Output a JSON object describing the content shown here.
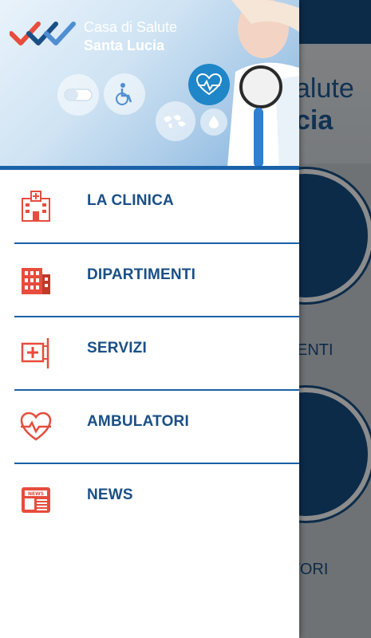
{
  "app": {
    "brand_line_1": "Casa di Salute",
    "brand_line_2": "Santa Lucia"
  },
  "background": {
    "title_line_1": "alute",
    "title_line_2": "cia",
    "label_1": "ENTI",
    "label_2": "TORI"
  },
  "drawer": {
    "items": [
      {
        "label": "LA CLINICA",
        "icon": "hospital-icon"
      },
      {
        "label": "DIPARTIMENTI",
        "icon": "building-icon"
      },
      {
        "label": "SERVIZI",
        "icon": "medical-sign-icon"
      },
      {
        "label": "AMBULATORI",
        "icon": "heart-pulse-icon"
      },
      {
        "label": "NEWS",
        "icon": "newspaper-icon"
      }
    ]
  },
  "colors": {
    "primary": "#1a4f86",
    "accent_red": "#e74c3c",
    "divider": "#1a62a8"
  }
}
